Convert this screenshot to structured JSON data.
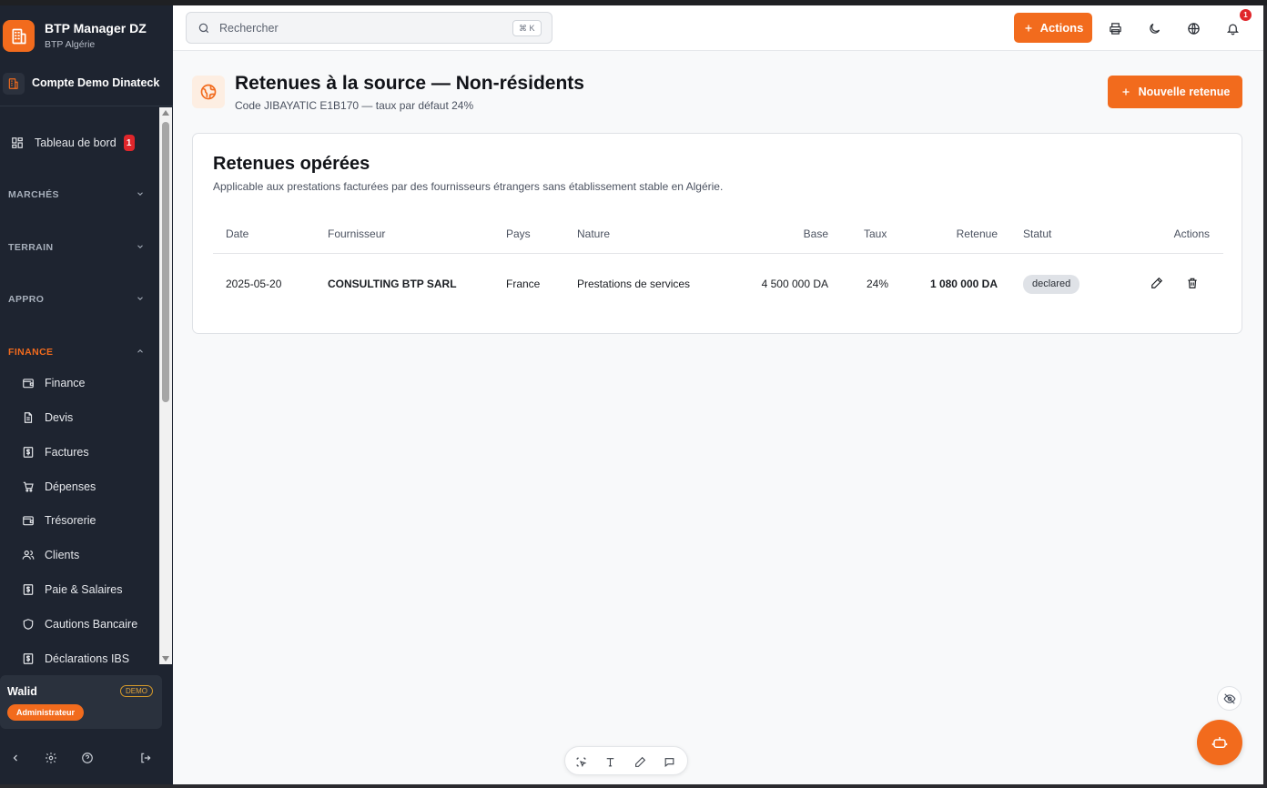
{
  "sidebar": {
    "brand_title": "BTP Manager DZ",
    "brand_subtitle": "BTP Algérie",
    "company": "Compte Demo Dinateck",
    "dashboard": {
      "label": "Tableau de bord",
      "badge": "1"
    },
    "sections": [
      {
        "label": "MARCHÉS",
        "expanded": false
      },
      {
        "label": "TERRAIN",
        "expanded": false
      },
      {
        "label": "APPRO",
        "expanded": false
      },
      {
        "label": "FINANCE",
        "expanded": true
      }
    ],
    "finance_items": [
      {
        "label": "Finance",
        "icon": "wallet-icon"
      },
      {
        "label": "Devis",
        "icon": "document-icon"
      },
      {
        "label": "Factures",
        "icon": "invoice-dollar-icon"
      },
      {
        "label": "Dépenses",
        "icon": "cart-icon"
      },
      {
        "label": "Trésorerie",
        "icon": "wallet-icon"
      },
      {
        "label": "Clients",
        "icon": "users-icon"
      },
      {
        "label": "Paie & Salaires",
        "icon": "invoice-dollar-icon"
      },
      {
        "label": "Cautions Bancaire",
        "icon": "shield-icon"
      },
      {
        "label": "Déclarations IBS",
        "icon": "invoice-dollar-icon"
      }
    ],
    "user": {
      "name": "Walid",
      "demo_badge": "DEMO",
      "role": "Administrateur"
    }
  },
  "topbar": {
    "search_placeholder": "Rechercher",
    "shortcut": "⌘ K",
    "actions_label": "Actions",
    "notifications_count": "1"
  },
  "page": {
    "title": "Retenues à la source — Non-résidents",
    "subtitle": "Code JIBAYATIC E1B170 — taux par défaut 24%",
    "new_button": "Nouvelle retenue"
  },
  "card": {
    "title": "Retenues opérées",
    "subtitle": "Applicable aux prestations facturées par des fournisseurs étrangers sans établissement stable en Algérie.",
    "columns": [
      "Date",
      "Fournisseur",
      "Pays",
      "Nature",
      "Base",
      "Taux",
      "Retenue",
      "Statut",
      "Actions"
    ],
    "rows": [
      {
        "date": "2025-05-20",
        "supplier": "CONSULTING BTP SARL",
        "country": "France",
        "nature": "Prestations de services",
        "base": "4 500 000 DA",
        "rate": "24%",
        "withholding": "1 080 000 DA",
        "status": "declared"
      }
    ]
  },
  "colors": {
    "accent": "#f26b1d",
    "sidebar_bg": "#1e2430",
    "danger": "#e0262b"
  }
}
